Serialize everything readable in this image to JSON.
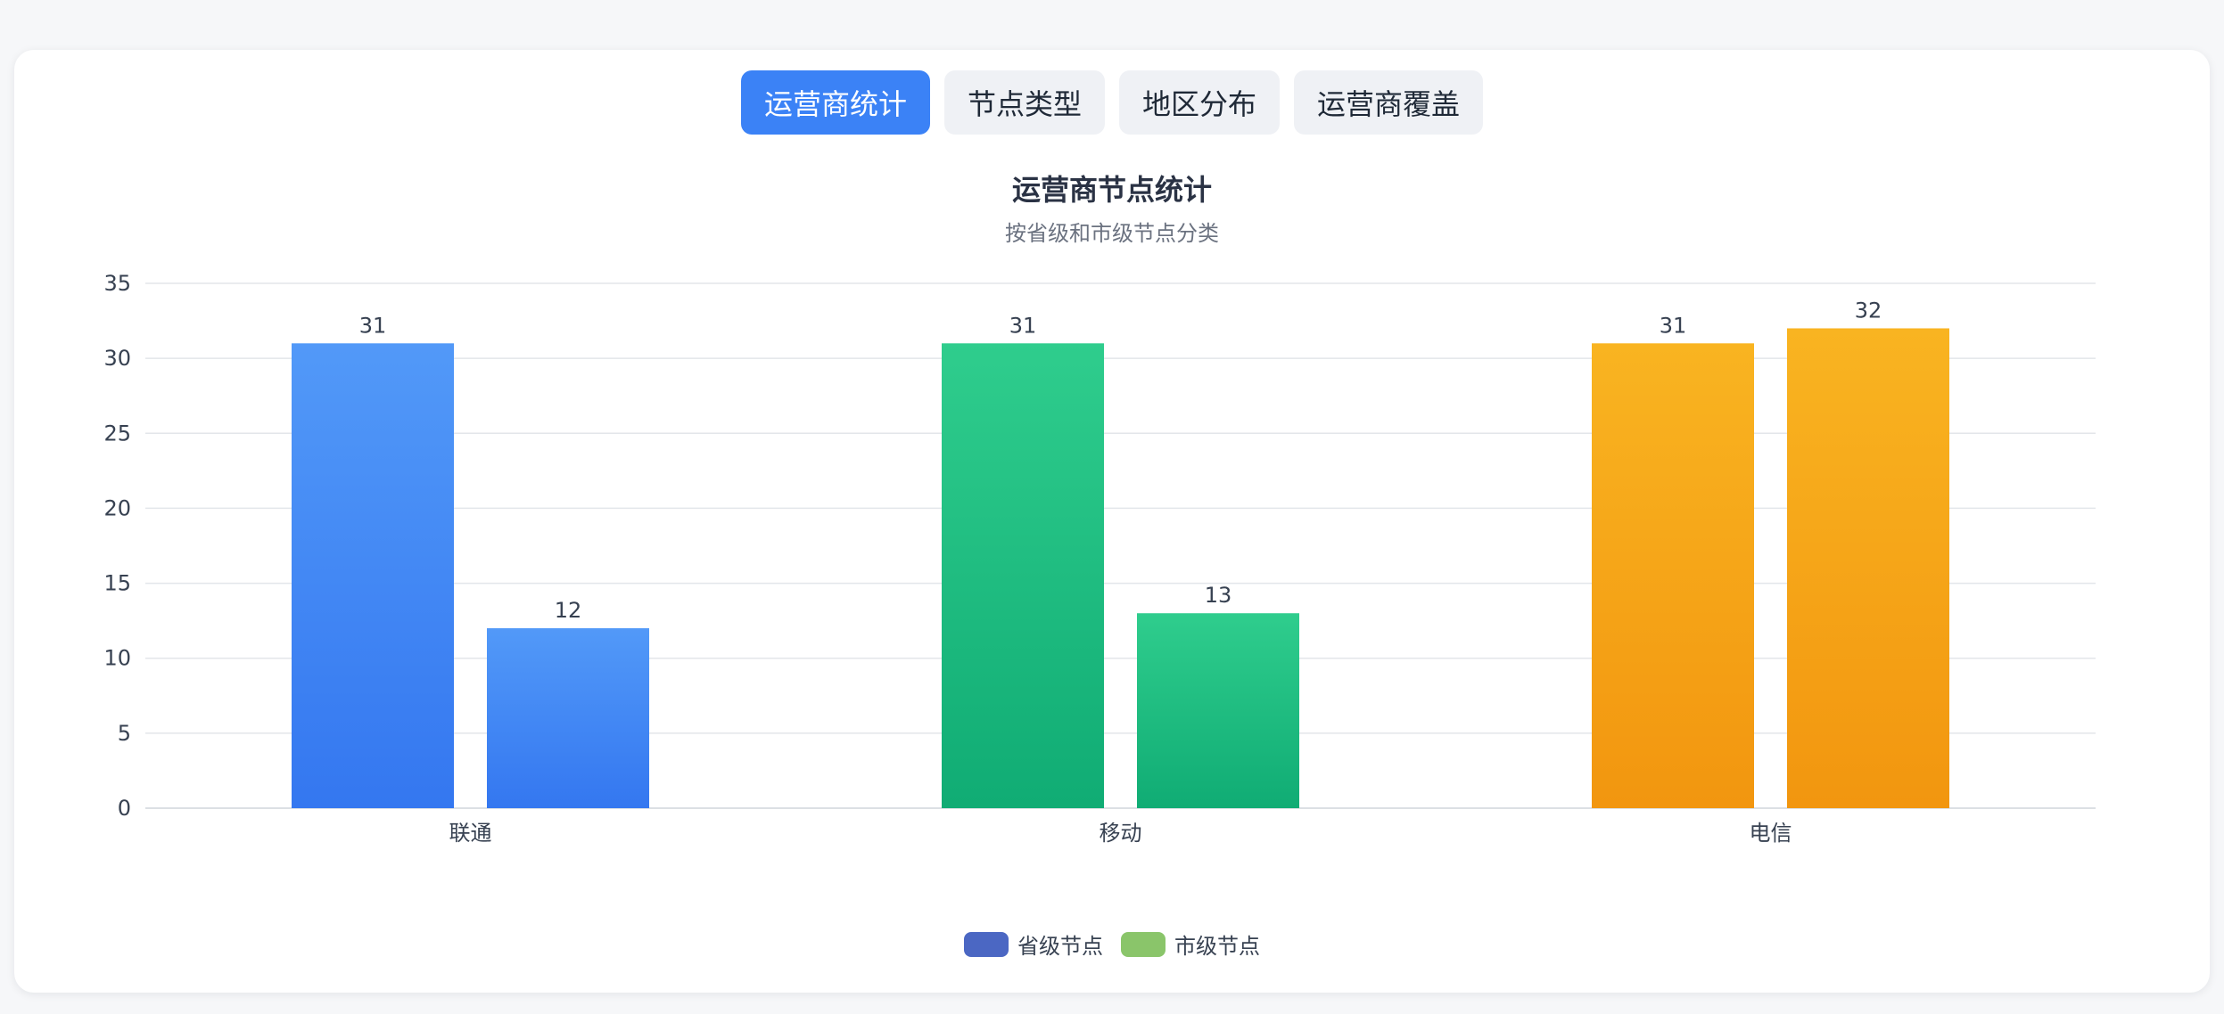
{
  "tabs": [
    {
      "label": "运营商统计",
      "active": true
    },
    {
      "label": "节点类型",
      "active": false
    },
    {
      "label": "地区分布",
      "active": false
    },
    {
      "label": "运营商覆盖",
      "active": false
    }
  ],
  "chart_data": {
    "type": "bar",
    "title": "运营商节点统计",
    "subtitle": "按省级和市级节点分类",
    "categories": [
      "联通",
      "移动",
      "电信"
    ],
    "series": [
      {
        "name": "省级节点",
        "values": [
          31,
          31,
          31
        ]
      },
      {
        "name": "市级节点",
        "values": [
          12,
          13,
          32
        ]
      }
    ],
    "ylim": [
      0,
      35
    ],
    "yticks": [
      0,
      5,
      10,
      15,
      20,
      25,
      30,
      35
    ],
    "grid": true,
    "legend_position": "bottom-center",
    "category_colors": [
      {
        "top": "#5299f8",
        "bottom": "#3477f0"
      },
      {
        "top": "#2fcd8d",
        "bottom": "#10ac74"
      },
      {
        "top": "#f9b421",
        "bottom": "#f2960f"
      }
    ],
    "legend_colors": [
      "#4b67c3",
      "#8ac56a"
    ]
  }
}
